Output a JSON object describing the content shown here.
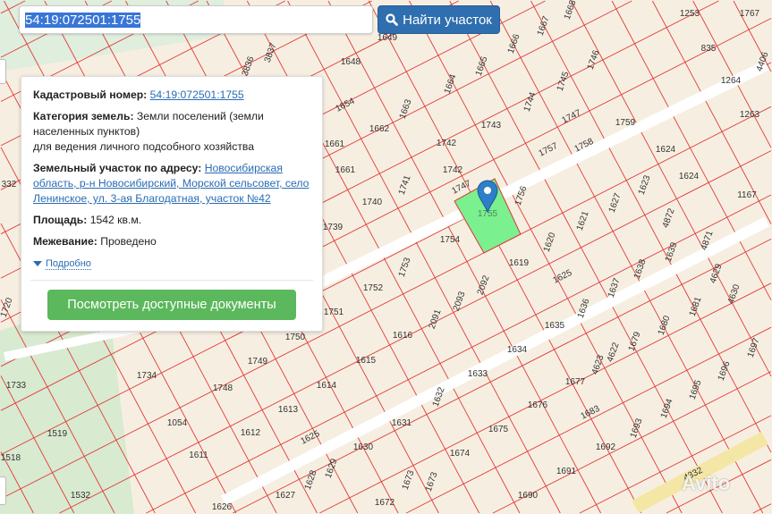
{
  "search": {
    "value": "54:19:072501:1755",
    "button_label": "Найти участок",
    "button_icon": "search-icon"
  },
  "info": {
    "cadastral_label": "Кадастровый номер:",
    "cadastral_value": "54:19:072501:1755",
    "category_label": "Категория земель:",
    "category_value": "Земли поселений (земли населенных пунктов)",
    "category_purpose": "для ведения личного подсобного хозяйства",
    "address_label": "Земельный участок по адресу:",
    "address_value": "Новосибирская область, р-н Новосибирский, Морской сельсовет, село Ленинское, ул. 3-ая Благодатная, участок №42",
    "area_label": "Площадь:",
    "area_value": "1542 кв.м.",
    "survey_label": "Межевание:",
    "survey_value": "Проведено",
    "more_label": "Подробно",
    "docs_button": "Посмотреть доступные документы"
  },
  "map": {
    "selected_parcel": "1755",
    "highlight_color": "#7af08f",
    "line_color": "#e23a3a",
    "parcels": [
      "1649",
      "1648",
      "1666",
      "1667",
      "1668",
      "1746",
      "1665",
      "1745",
      "1664",
      "1744",
      "1663",
      "1662",
      "1743",
      "1747",
      "1759",
      "1661",
      "1742",
      "1757",
      "1758",
      "1624",
      "1661",
      "1742",
      "1741",
      "1740",
      "1747",
      "1756",
      "1623",
      "1627",
      "1167",
      "1739",
      "1754",
      "1755",
      "1621",
      "4872",
      "1620",
      "1639",
      "4871",
      "1619",
      "1753",
      "1752",
      "2092",
      "1625",
      "1637",
      "1638",
      "4629",
      "4630",
      "1751",
      "2093",
      "2091",
      "1636",
      "1681",
      "1635",
      "1750",
      "1616",
      "1680",
      "1679",
      "1749",
      "1615",
      "1634",
      "4622",
      "4623",
      "1697",
      "1696",
      "1734",
      "1748",
      "1614",
      "1633",
      "1677",
      "1695",
      "1733",
      "1613",
      "1632",
      "1676",
      "1694",
      "1054",
      "1612",
      "1631",
      "1675",
      "1683",
      "1693",
      "1519",
      "1625",
      "1630",
      "1674",
      "1692",
      "1611",
      "1629",
      "1628",
      "1673",
      "1673",
      "1691",
      "1690",
      "1627",
      "1672",
      "1626",
      "1532",
      "1518",
      "1720",
      "332",
      "1253",
      "1767",
      "835",
      "1264",
      "1263",
      "4406",
      "4332",
      "3836",
      "3837",
      "1654",
      "1624"
    ]
  },
  "watermark": "Avito"
}
